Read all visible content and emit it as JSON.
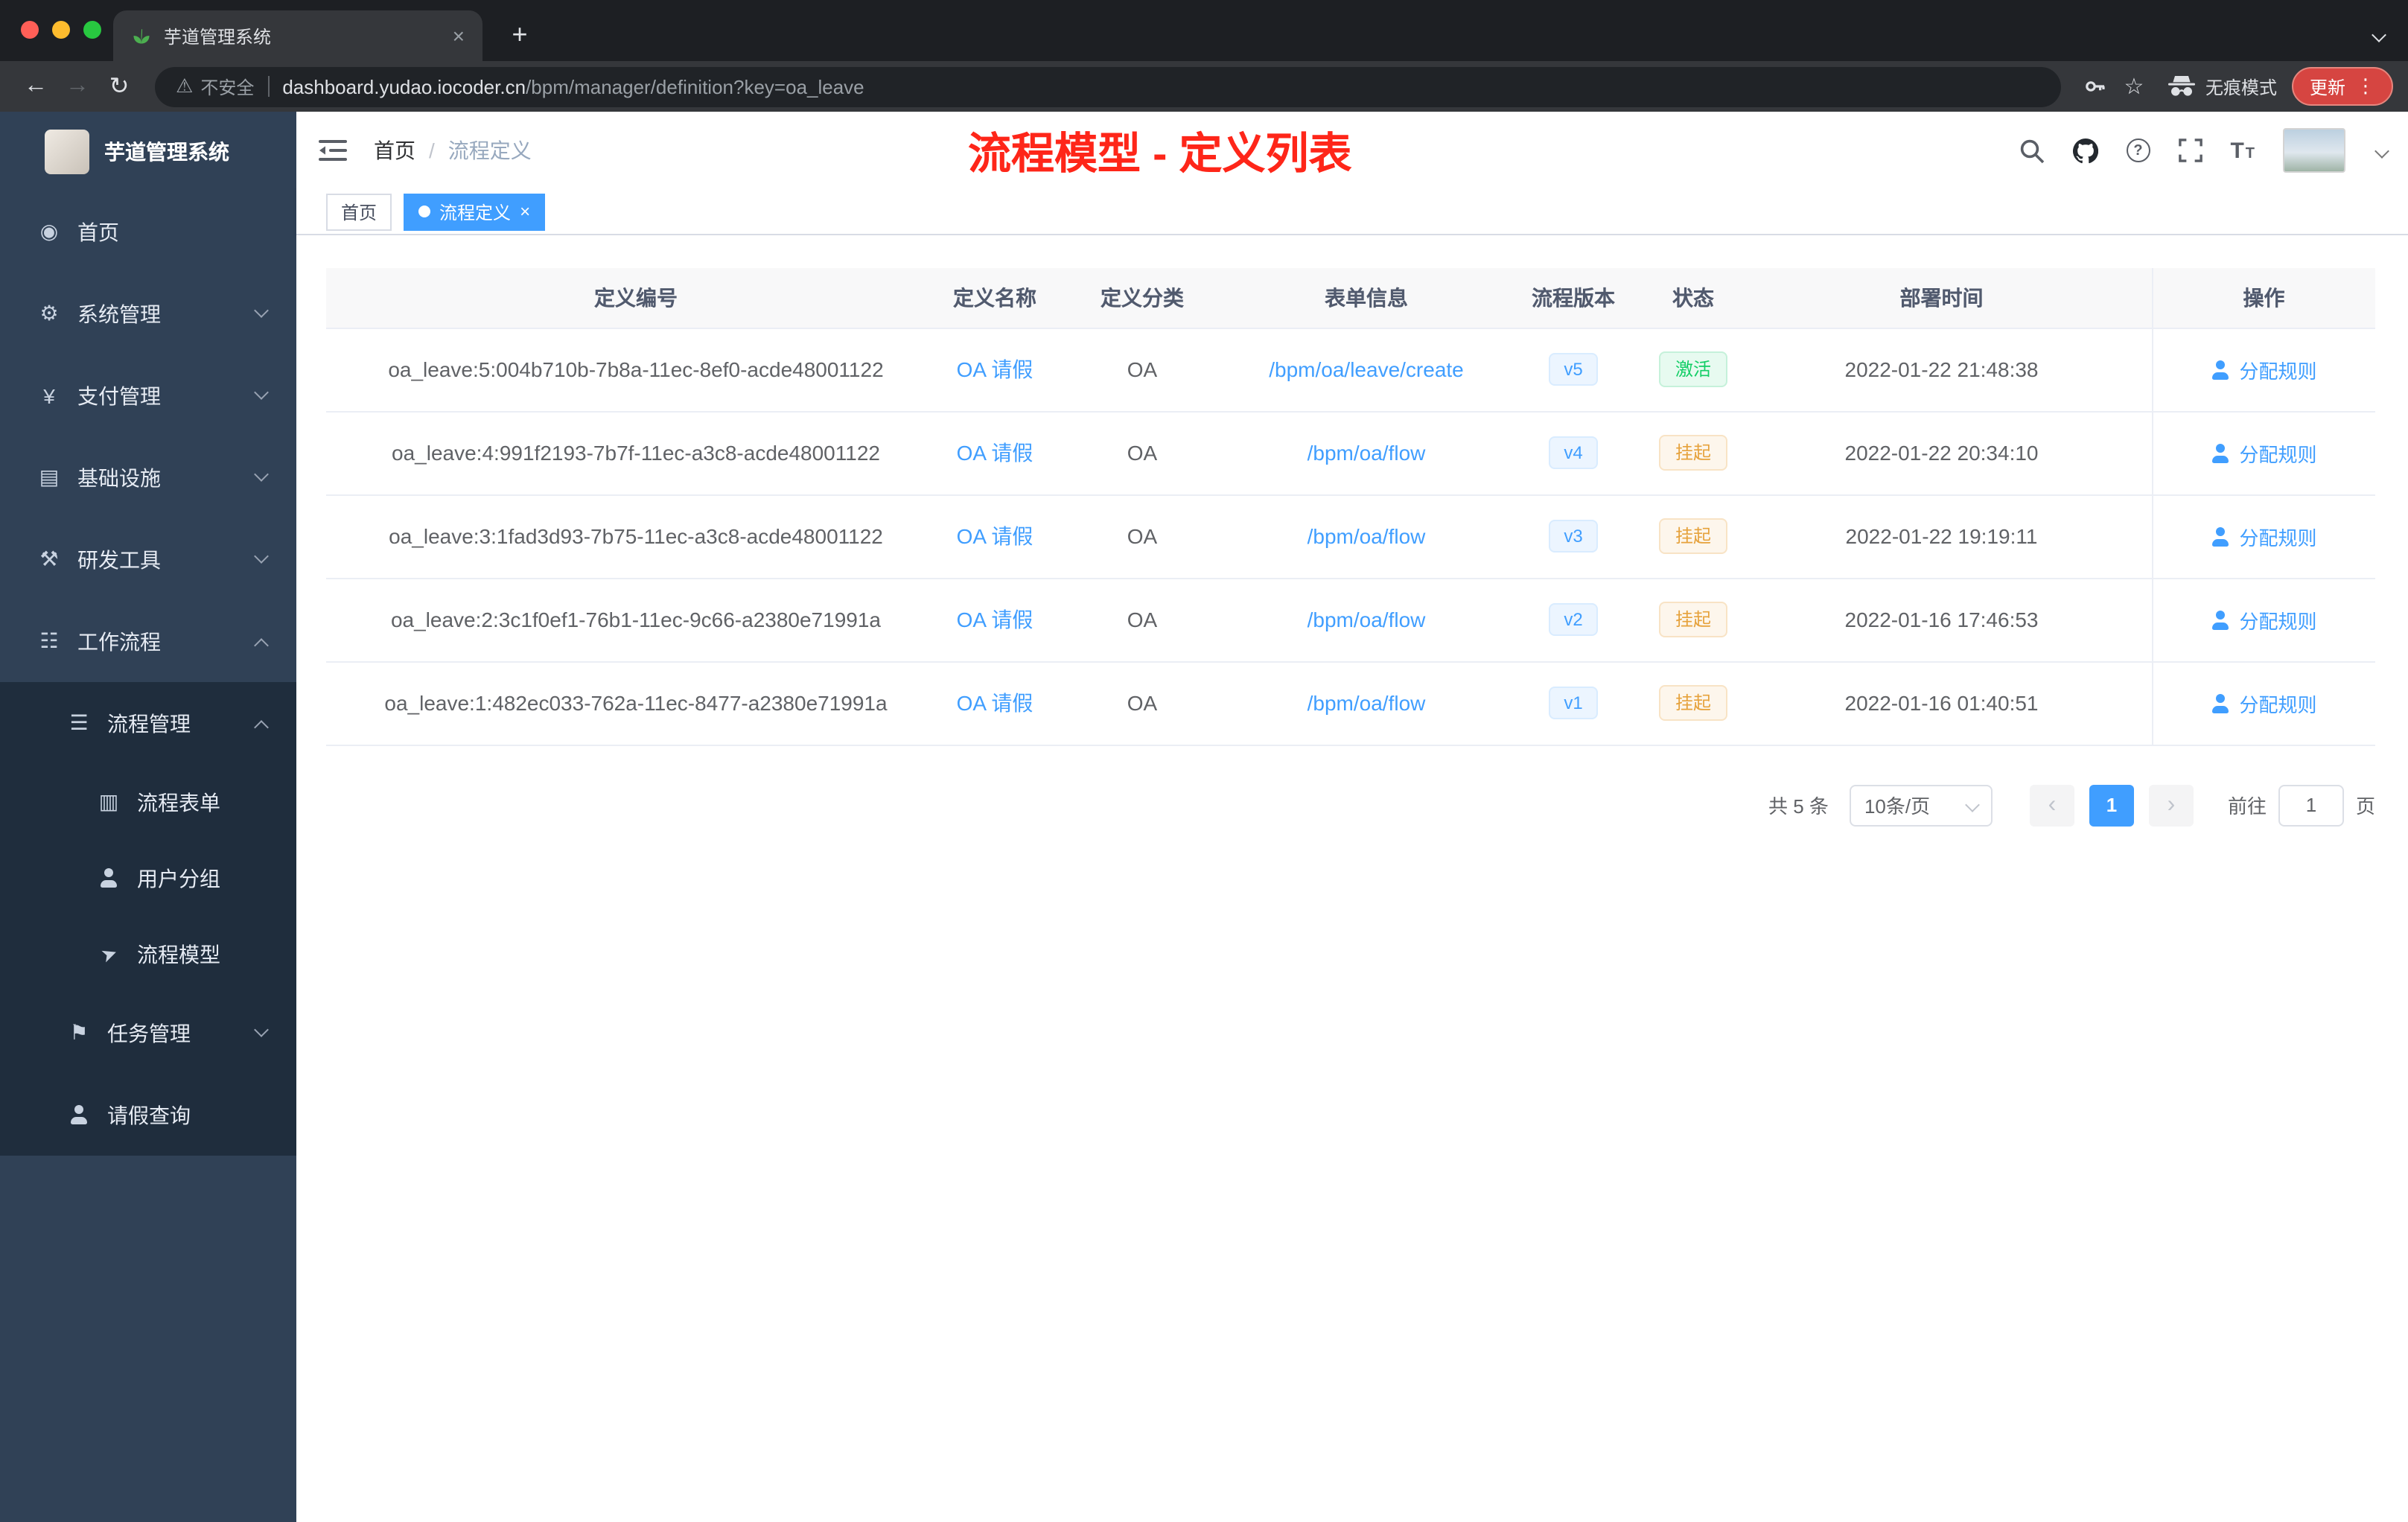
{
  "colors": {
    "accent": "#409eff",
    "annotation_red": "#fe2619",
    "status_active_green": "#13ce66",
    "status_suspend_orange": "#e6a23c",
    "sidebar_bg": "#304156",
    "submenu_bg": "#1f2d3d",
    "update_pill_red": "#d64541"
  },
  "browser": {
    "tab": {
      "title": "芋道管理系统",
      "close": "×"
    },
    "newtab": "+",
    "nav": {
      "back": "←",
      "forward": "→",
      "reload": "↻"
    },
    "address": {
      "security": "不安全",
      "warn": "⚠",
      "domain": "dashboard.yudao.iocoder.cn",
      "path": "/bpm/manager/definition?key=oa_leave",
      "star": "☆",
      "incognito": "无痕模式",
      "update": "更新",
      "dots": "⋮"
    }
  },
  "sidebar": {
    "logo_title": "芋道管理系统",
    "items": [
      {
        "label": "首页",
        "icon": "◉"
      },
      {
        "label": "系统管理",
        "icon": "⚙"
      },
      {
        "label": "支付管理",
        "icon": "¥"
      },
      {
        "label": "基础设施",
        "icon": "▤"
      },
      {
        "label": "研发工具",
        "icon": "⚒"
      },
      {
        "label": "工作流程",
        "icon": "☷"
      },
      {
        "label": "流程管理",
        "icon": "☰"
      },
      {
        "label": "流程表单",
        "icon": "▥"
      },
      {
        "label": "用户分组",
        "icon": ""
      },
      {
        "label": "流程模型",
        "icon": "➤"
      },
      {
        "label": "任务管理",
        "icon": "⚑"
      },
      {
        "label": "请假查询",
        "icon": ""
      }
    ]
  },
  "header": {
    "breadcrumb_home": "首页",
    "breadcrumb_sep": "/",
    "breadcrumb_current": "流程定义",
    "annotation": "流程模型 - 定义列表",
    "question_mark": "?",
    "size_big": "T",
    "size_small": "T"
  },
  "tags": {
    "home": "首页",
    "active": "流程定义",
    "close": "×"
  },
  "table": {
    "columns": {
      "id": "定义编号",
      "name": "定义名称",
      "category": "定义分类",
      "form": "表单信息",
      "version": "流程版本",
      "status": "状态",
      "time": "部署时间",
      "action": "操作"
    },
    "rows": [
      {
        "id": "oa_leave:5:004b710b-7b8a-11ec-8ef0-acde48001122",
        "name": "OA 请假",
        "category": "OA",
        "form": "/bpm/oa/leave/create",
        "version": "v5",
        "status": "激活",
        "status_type": "success",
        "time": "2022-01-22 21:48:38",
        "action": "分配规则"
      },
      {
        "id": "oa_leave:4:991f2193-7b7f-11ec-a3c8-acde48001122",
        "name": "OA 请假",
        "category": "OA",
        "form": "/bpm/oa/flow",
        "version": "v4",
        "status": "挂起",
        "status_type": "warning",
        "time": "2022-01-22 20:34:10",
        "action": "分配规则"
      },
      {
        "id": "oa_leave:3:1fad3d93-7b75-11ec-a3c8-acde48001122",
        "name": "OA 请假",
        "category": "OA",
        "form": "/bpm/oa/flow",
        "version": "v3",
        "status": "挂起",
        "status_type": "warning",
        "time": "2022-01-22 19:19:11",
        "action": "分配规则"
      },
      {
        "id": "oa_leave:2:3c1f0ef1-76b1-11ec-9c66-a2380e71991a",
        "name": "OA 请假",
        "category": "OA",
        "form": "/bpm/oa/flow",
        "version": "v2",
        "status": "挂起",
        "status_type": "warning",
        "time": "2022-01-16 17:46:53",
        "action": "分配规则"
      },
      {
        "id": "oa_leave:1:482ec033-762a-11ec-8477-a2380e71991a",
        "name": "OA 请假",
        "category": "OA",
        "form": "/bpm/oa/flow",
        "version": "v1",
        "status": "挂起",
        "status_type": "warning",
        "time": "2022-01-16 01:40:51",
        "action": "分配规则"
      }
    ]
  },
  "pagination": {
    "total": "共 5 条",
    "size": "10条/页",
    "prev": "‹",
    "page": "1",
    "next": "›",
    "goto": "前往",
    "goto_value": "1",
    "unit": "页"
  }
}
